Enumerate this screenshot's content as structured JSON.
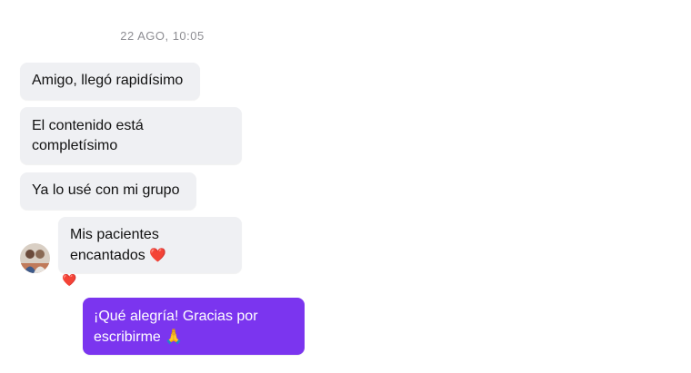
{
  "conversation": {
    "timestamp": "22 AGO, 10:05",
    "incoming": [
      {
        "text": "Amigo, llegó rapidísimo"
      },
      {
        "text": "El contenido está completísimo"
      },
      {
        "text": "Ya lo usé con mi grupo"
      },
      {
        "text": "Mis pacientes encantados",
        "emoji": "❤️"
      }
    ],
    "reaction": "❤️",
    "outgoing": [
      {
        "text": "¡Qué alegría! Gracias por escribirme",
        "emoji": "🙏"
      }
    ]
  },
  "colors": {
    "incoming_bubble": "#eff0f3",
    "outgoing_bubble": "#7b35ef",
    "heart": "#e0182d",
    "timestamp": "#8e8e93"
  }
}
